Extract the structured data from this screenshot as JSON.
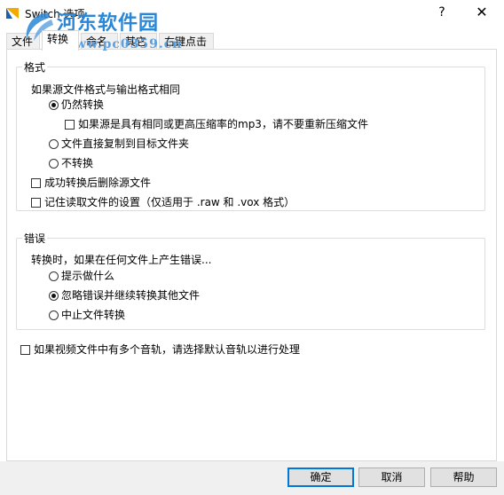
{
  "window": {
    "title": "Switch 选项",
    "help_glyph": "?",
    "close_glyph": "✕"
  },
  "watermark": {
    "main": "河东软件园",
    "sub": "www.pc0359.cn"
  },
  "tabs": [
    {
      "label": "文件",
      "active": false
    },
    {
      "label": "转换",
      "active": true
    },
    {
      "label": "命名",
      "active": false
    },
    {
      "label": "其它",
      "active": false
    },
    {
      "label": "右键点击",
      "active": false
    }
  ],
  "format_group": {
    "label": "格式",
    "question": "如果源文件格式与输出格式相同",
    "opt_convert": "仍然转换",
    "opt_no_recompress": "如果源是具有相同或更高压缩率的mp3，请不要重新压缩文件",
    "opt_copy": "文件直接复制到目标文件夹",
    "opt_noconvert": "不转换",
    "opt_delete": "成功转换后删除源文件",
    "opt_remember": "记住读取文件的设置（仅适用于 .raw 和 .vox 格式）"
  },
  "error_group": {
    "label": "错误",
    "question": "转换时，如果在任何文件上产生错误...",
    "opt_ask": "提示做什么",
    "opt_ignore": "忽略错误并继续转换其他文件",
    "opt_stop": "中止文件转换"
  },
  "audio_track": "如果视频文件中有多个音轨，请选择默认音轨以进行处理",
  "buttons": {
    "ok": "确定",
    "cancel": "取消",
    "help": "帮助"
  },
  "colors": {
    "accent": "#0078d7",
    "watermark": "#2a86d6"
  }
}
